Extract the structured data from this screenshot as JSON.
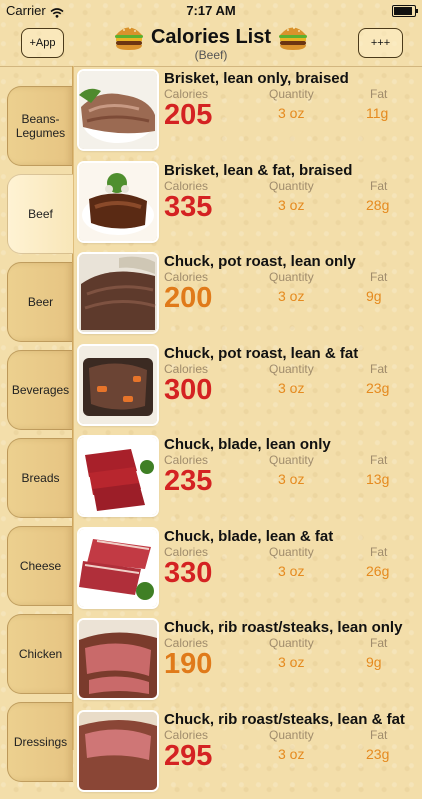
{
  "status": {
    "carrier": "Carrier",
    "time": "7:17 AM",
    "battery_level": 1.0
  },
  "nav": {
    "left_button": "+App",
    "title": "Calories List",
    "subtitle": "(Beef)",
    "right_button": "+++"
  },
  "tabs": [
    {
      "label": "Beans-\nLegumes",
      "active": false
    },
    {
      "label": "Beef",
      "active": true
    },
    {
      "label": "Beer",
      "active": false
    },
    {
      "label": "Beverages",
      "active": false
    },
    {
      "label": "Breads",
      "active": false
    },
    {
      "label": "Cheese",
      "active": false
    },
    {
      "label": "Chicken",
      "active": false
    },
    {
      "label": "Dressings",
      "active": false
    }
  ],
  "labels": {
    "calories": "Calories",
    "quantity": "Quantity",
    "fat": "Fat"
  },
  "items": [
    {
      "name": "Brisket, lean only, braised",
      "calories": "205",
      "quantity": "3 oz",
      "fat": "11g",
      "cal_color": "#d42222",
      "image": "roast"
    },
    {
      "name": "Brisket, lean & fat, braised",
      "calories": "335",
      "quantity": "3 oz",
      "fat": "28g",
      "cal_color": "#d42222",
      "image": "braised"
    },
    {
      "name": "Chuck, pot roast, lean only",
      "calories": "200",
      "quantity": "3 oz",
      "fat": "9g",
      "cal_color": "#e07a1a",
      "image": "slices"
    },
    {
      "name": "Chuck, pot roast, lean & fat",
      "calories": "300",
      "quantity": "3 oz",
      "fat": "23g",
      "cal_color": "#d42222",
      "image": "stew"
    },
    {
      "name": "Chuck, blade, lean only",
      "calories": "235",
      "quantity": "3 oz",
      "fat": "13g",
      "cal_color": "#d42222",
      "image": "raw"
    },
    {
      "name": "Chuck, blade, lean & fat",
      "calories": "330",
      "quantity": "3 oz",
      "fat": "26g",
      "cal_color": "#d42222",
      "image": "raw2"
    },
    {
      "name": "Chuck, rib roast/steaks, lean only",
      "calories": "190",
      "quantity": "3 oz",
      "fat": "9g",
      "cal_color": "#e07a1a",
      "image": "rib"
    },
    {
      "name": "Chuck, rib roast/steaks, lean & fat",
      "calories": "295",
      "quantity": "3 oz",
      "fat": "23g",
      "cal_color": "#d42222",
      "image": "rib2"
    }
  ]
}
